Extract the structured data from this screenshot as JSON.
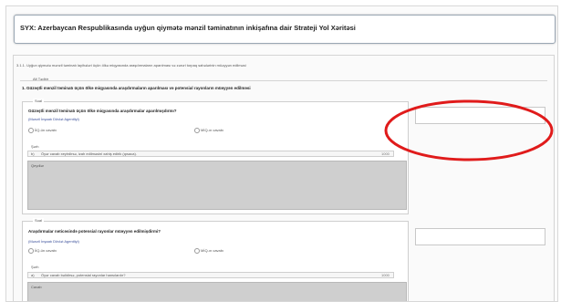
{
  "page_title": "SYX: Azerbaycan Respublikasında uyğun qiymətə mənzil təminatının inkişafına dair Strateji Yol Xəritəsi",
  "section": {
    "label": "Tədbir",
    "text": "3.1.1. Uyğun qiymətə mənzil təminatı layihələri üçün ölkə miqyasında araşdırmaların aparılması və zəruri torpaq sahələrinin müəyyən edilməsi"
  },
  "subsection": {
    "label": "Alt Tədbir",
    "text": "1. Güzəştli mənzil təminatı üçün ölkə miqyasında araşdırmaların aparılması və potensial rayonların müəyyən edilməsi"
  },
  "questions": [
    {
      "label": "Sual",
      "text": "Güzəştli mənzil təminatı üçün ölkə miqyasında araşdırmalar aparılmışdırmı?",
      "agency": "(Mənzil İnşaatı Dövlət Agentliyi)",
      "option_left": "İİQ-ün cavabı",
      "option_right": "MİQ-ın cavabı",
      "reply_label": "Şərh",
      "subfield_letter": "b)",
      "subfield_text": "Öyər cavab xeyirdirsə, izah edilməsini xahiş edirik (qısaca).",
      "counter": "1000",
      "textarea_placeholder": "Qeydlər"
    },
    {
      "label": "Sual",
      "text": "Araşdırmalar nəticəsində potensial rayonlar müəyyən edilmişdirmi?",
      "agency": "(Mənzil İnşaatı Dövlət Agentliyi)",
      "option_left": "İİQ-ün cavabı",
      "option_right": "MİQ-ın cavabı",
      "reply_label": "Şərh",
      "subfield_letter": "a)",
      "subfield_text": "Öyər cavab bəlidirsə, potensial rayonlar hansılardır?",
      "counter": "1000",
      "textarea_placeholder": "Cavab"
    }
  ],
  "colors": {
    "annotation": "#e01b1b"
  }
}
